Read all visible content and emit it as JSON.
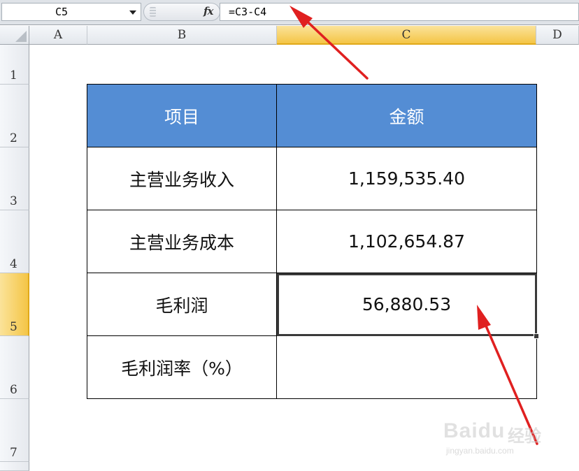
{
  "formula_bar": {
    "name_box": "C5",
    "fx_label": "fx",
    "formula": "=C3-C4"
  },
  "columns": [
    "A",
    "B",
    "C",
    "D"
  ],
  "rows": [
    "1",
    "2",
    "3",
    "4",
    "5",
    "6",
    "7"
  ],
  "selection": {
    "column": "C",
    "row": "5"
  },
  "table": {
    "headers": [
      "项目",
      "金额"
    ],
    "rows": [
      {
        "item": "主营业务收入",
        "amount": "1,159,535.40"
      },
      {
        "item": "主营业务成本",
        "amount": "1,102,654.87"
      },
      {
        "item": "毛利润",
        "amount": "56,880.53"
      },
      {
        "item": "毛利润率（%）",
        "amount": ""
      }
    ]
  },
  "watermark": {
    "brand": "Baidu",
    "cn": "经验",
    "url": "jingyan.baidu.com"
  },
  "colors": {
    "header_fill": "#548dd4",
    "header_text": "#ffffff",
    "active_header": "#f4c546",
    "arrow": "#e02020"
  }
}
